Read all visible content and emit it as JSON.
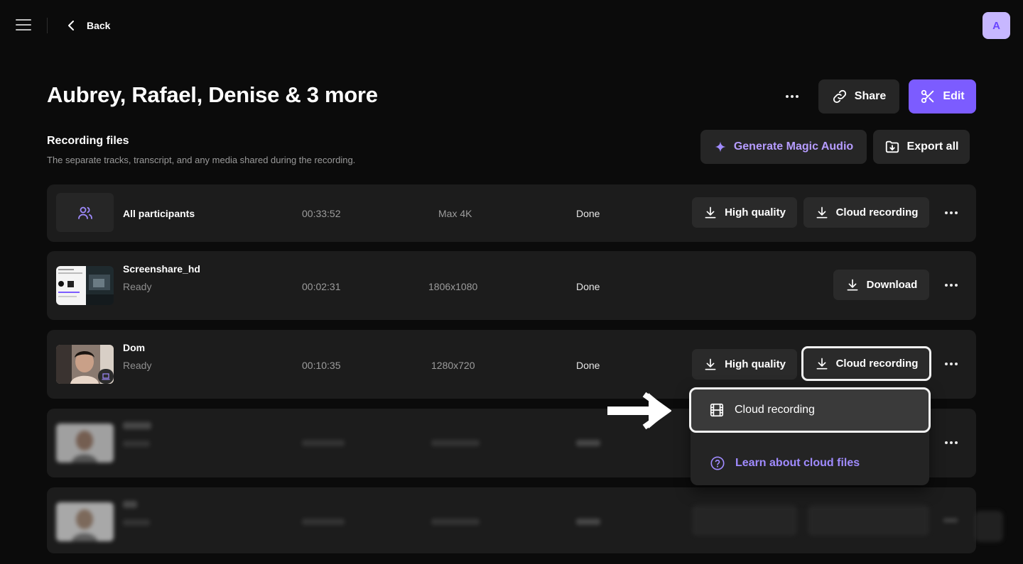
{
  "topbar": {
    "back_label": "Back",
    "avatar_initial": "A"
  },
  "header": {
    "title": "Aubrey, Rafael, Denise & 3 more",
    "share_label": "Share",
    "edit_label": "Edit"
  },
  "section": {
    "title": "Recording files",
    "subtitle": "The separate tracks, transcript, and any media shared during the recording.",
    "magic_audio_label": "Generate Magic Audio",
    "export_all_label": "Export all"
  },
  "rows": [
    {
      "name": "All participants",
      "duration": "00:33:52",
      "resolution": "Max 4K",
      "state": "Done",
      "btn1": "High quality",
      "btn2": "Cloud recording"
    },
    {
      "name": "Screenshare_hd",
      "status": "Ready",
      "duration": "00:02:31",
      "resolution": "1806x1080",
      "state": "Done",
      "btn1": "Download"
    },
    {
      "name": "Dom",
      "status": "Ready",
      "duration": "00:10:35",
      "resolution": "1280x720",
      "state": "Done",
      "btn1": "High quality",
      "btn2": "Cloud recording"
    }
  ],
  "dropdown": {
    "cloud_label": "Cloud recording",
    "learn_label": "Learn about cloud files"
  },
  "colors": {
    "accent": "#7c5cff",
    "accent_text": "#a08bff",
    "background": "#0b0b0b",
    "row_bg": "#1c1c1c"
  }
}
